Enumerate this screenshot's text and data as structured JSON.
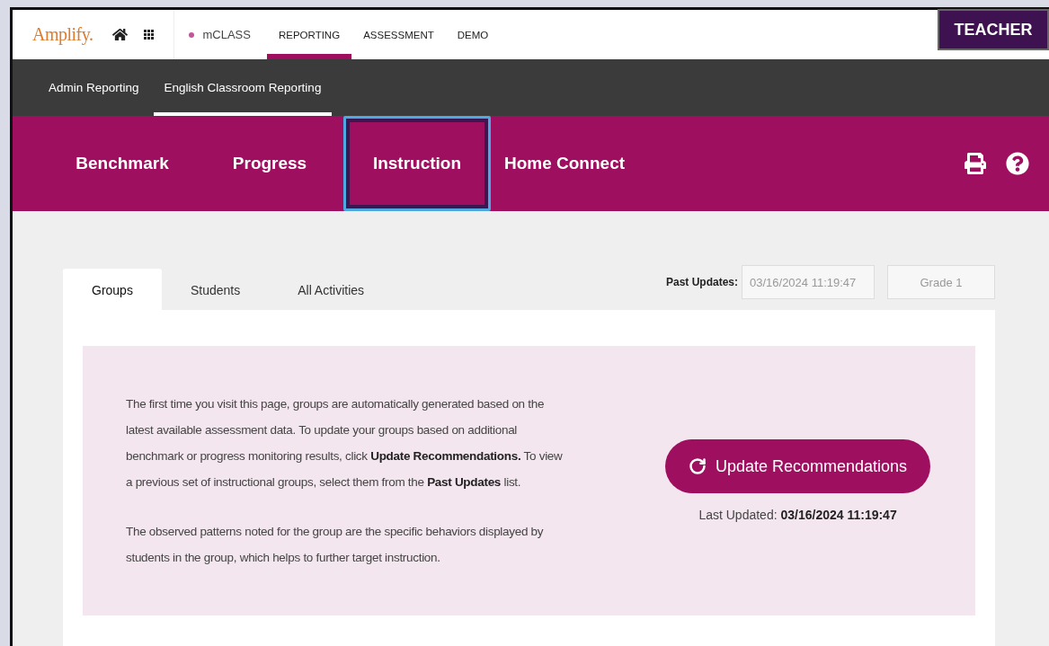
{
  "header": {
    "logo": "Amplify.",
    "product": "mCLASS",
    "nav": [
      {
        "label": "REPORTING",
        "selected": true
      },
      {
        "label": "ASSESSMENT",
        "selected": false
      },
      {
        "label": "DEMO",
        "selected": false
      }
    ]
  },
  "role_badge": "TEACHER",
  "subnav": [
    {
      "label": "Admin Reporting",
      "selected": false
    },
    {
      "label": "English Classroom Reporting",
      "selected": true
    }
  ],
  "main_tabs": [
    {
      "label": "Benchmark",
      "selected": false
    },
    {
      "label": "Progress",
      "selected": false
    },
    {
      "label": "Instruction",
      "selected": true
    },
    {
      "label": "Home Connect",
      "selected": false
    }
  ],
  "content": {
    "tabs": [
      {
        "label": "Groups",
        "selected": true
      },
      {
        "label": "Students",
        "selected": false
      },
      {
        "label": "All Activities",
        "selected": false
      }
    ],
    "past_updates": {
      "label": "Past Updates:",
      "value": "03/16/2024 11:19:47"
    },
    "grade": {
      "value": "Grade 1"
    },
    "info": {
      "paragraphs": [
        "The first time you visit this page, groups are automatically generated based on the latest available assessment data. To update your groups based on additional benchmark or progress monitoring results, click **Update Recommendations.** To view a previous set of instructional groups, select them from the **Past Updates** list.",
        "The observed patterns noted for the group are the specific behaviors displayed by students in the group, which helps to further target instruction."
      ],
      "button": "Update Recommendations",
      "last_updated_label": "Last Updated:",
      "last_updated_value": "03/16/2024 11:19:47"
    }
  }
}
